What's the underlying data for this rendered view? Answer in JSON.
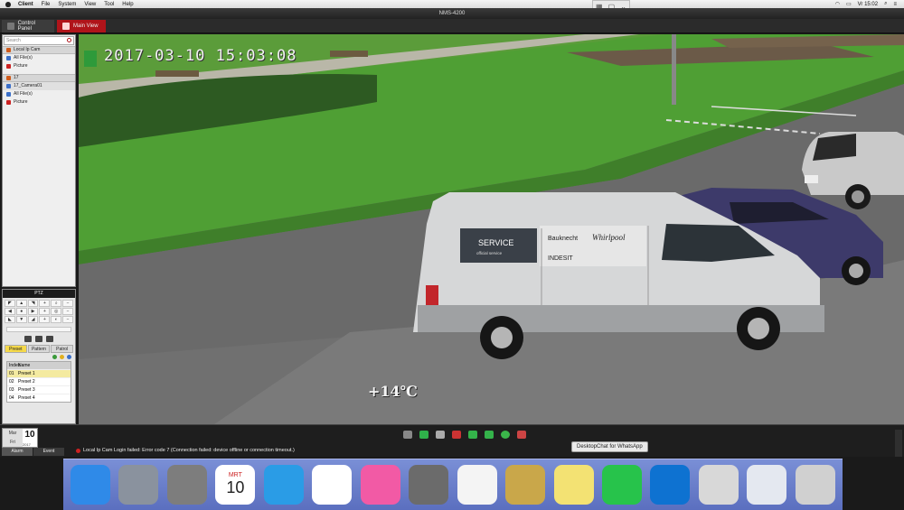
{
  "menubar": {
    "app": "Client",
    "items": [
      "File",
      "System",
      "View",
      "Tool",
      "Help"
    ],
    "clock": "Vr 15:02"
  },
  "window": {
    "title": "NMS-4200"
  },
  "tabs": [
    {
      "label": "Control Panel"
    },
    {
      "label": "Main View"
    }
  ],
  "sidebar": {
    "search_placeholder": "Search",
    "tree": [
      {
        "label": "Local Ip Cam",
        "type": "group"
      },
      {
        "label": "All File(s)",
        "type": "file"
      },
      {
        "label": "Picture",
        "type": "picture"
      },
      {
        "label": "17",
        "type": "group"
      },
      {
        "label": "17_Camera01",
        "type": "camera"
      },
      {
        "label": "All File(s)",
        "type": "file"
      },
      {
        "label": "Picture",
        "type": "picture"
      }
    ]
  },
  "ptz": {
    "title": "PTZ",
    "tabs": [
      "Preset",
      "Pattern",
      "Patrol"
    ],
    "active_tab": "Preset",
    "table_headers": [
      "Index",
      "Name"
    ],
    "presets": [
      {
        "index": "01",
        "name": "Preset 1"
      },
      {
        "index": "02",
        "name": "Preset 2"
      },
      {
        "index": "03",
        "name": "Preset 3"
      },
      {
        "index": "04",
        "name": "Preset 4"
      }
    ]
  },
  "video": {
    "timestamp": "2017-03-10 15:03:08",
    "temperature": "+14℃",
    "van_text": [
      "SERVICE",
      "Bauknecht",
      "Whirlpool",
      "INDESIT",
      "official service"
    ]
  },
  "bottom": {
    "date_month": "Mar",
    "date_weekday": "Fri",
    "date_day": "10",
    "date_year": "2017",
    "log_tabs": [
      "Alarm",
      "Event"
    ],
    "log_message": "Local Ip Cam Login failed: Error code 7 (Connection failed: device offline or connection timeout.)",
    "tooltip": "DesktopChat for WhatsApp"
  },
  "dock": {
    "apps": [
      {
        "name": "Finder",
        "color": "#2f8ae8"
      },
      {
        "name": "Launchpad",
        "color": "#8a929e"
      },
      {
        "name": "System Preferences",
        "color": "#7d7d7d"
      },
      {
        "name": "Calendar",
        "color": "#ffffff",
        "month": "MRT",
        "day": "10"
      },
      {
        "name": "Safari",
        "color": "#2a9ce6"
      },
      {
        "name": "Chrome",
        "color": "#ffffff"
      },
      {
        "name": "iTunes",
        "color": "#f25aa5"
      },
      {
        "name": "Calculator",
        "color": "#6b6b6b"
      },
      {
        "name": "TextEdit",
        "color": "#f4f4f4"
      },
      {
        "name": "Preview",
        "color": "#c9a74a"
      },
      {
        "name": "Stickies",
        "color": "#f3e273"
      },
      {
        "name": "WhatsApp",
        "color": "#27c34b"
      },
      {
        "name": "TeamViewer",
        "color": "#0e72d1"
      },
      {
        "name": "Webcam",
        "color": "#d8d8d8"
      },
      {
        "name": "Network Utility",
        "color": "#e4e8f0"
      },
      {
        "name": "Trash",
        "color": "#d0d0d0"
      }
    ]
  }
}
